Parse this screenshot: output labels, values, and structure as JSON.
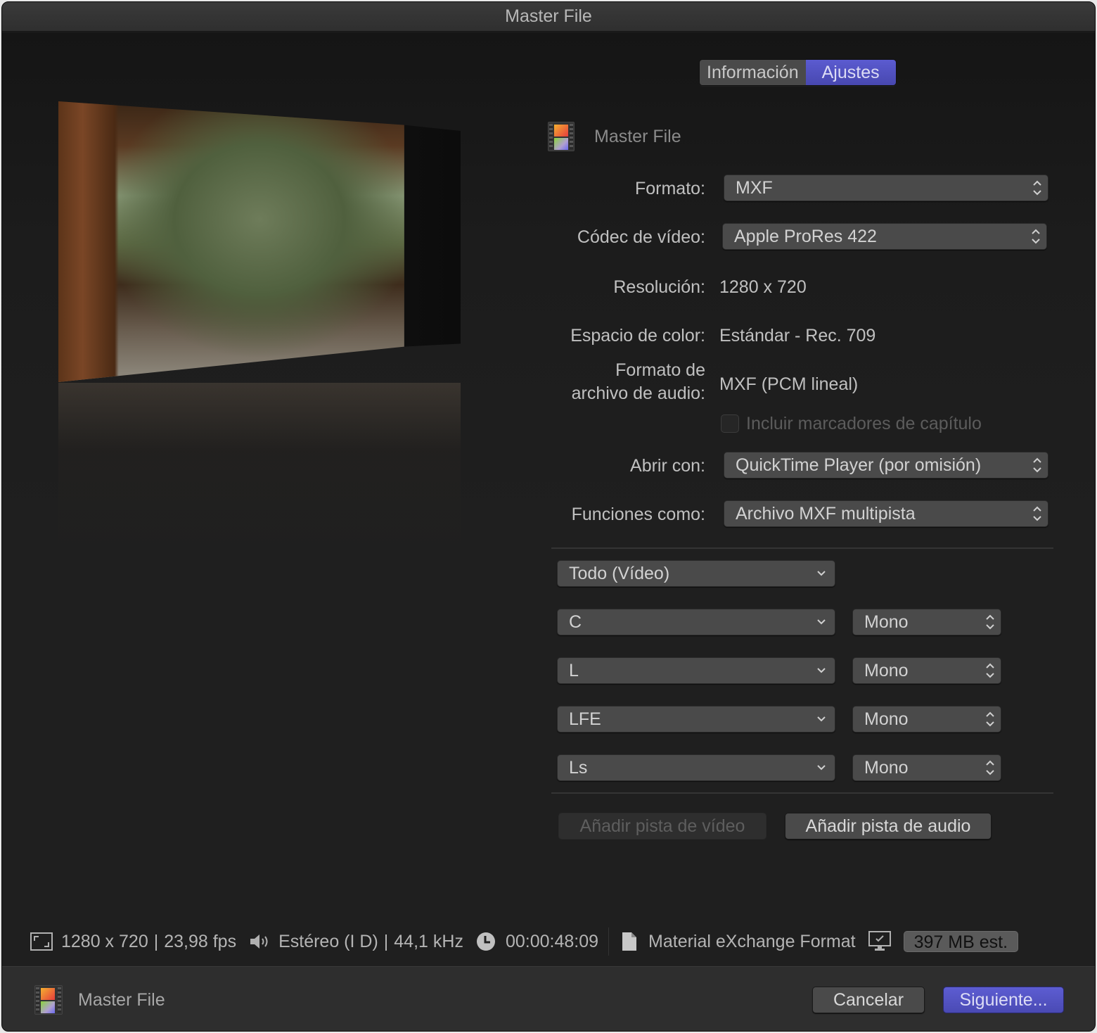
{
  "window": {
    "title": "Master File"
  },
  "tabs": [
    {
      "label": "Información",
      "active": false
    },
    {
      "label": "Ajustes",
      "active": true
    }
  ],
  "settings": {
    "name": "Master File",
    "format": {
      "label": "Formato:",
      "value": "MXF"
    },
    "video_codec": {
      "label": "Códec de vídeo:",
      "value": "Apple ProRes 422"
    },
    "resolution": {
      "label": "Resolución:",
      "value": "1280 x 720"
    },
    "color_space": {
      "label": "Espacio de color:",
      "value": "Estándar - Rec. 709"
    },
    "audio_format": {
      "label_line1": "Formato de",
      "label_line2": "archivo de audio:",
      "value": "MXF (PCM lineal)"
    },
    "chapter_markers": {
      "label": "Incluir marcadores de capítulo",
      "checked": false,
      "enabled": false
    },
    "open_with": {
      "label": "Abrir con:",
      "value": "QuickTime Player (por omisión)"
    },
    "roles_as": {
      "label": "Funciones como:",
      "value": "Archivo MXF multipista"
    }
  },
  "tracks": {
    "video": "Todo (Vídeo)",
    "audio": [
      {
        "role": "C",
        "channels": "Mono"
      },
      {
        "role": "L",
        "channels": "Mono"
      },
      {
        "role": "LFE",
        "channels": "Mono"
      },
      {
        "role": "Ls",
        "channels": "Mono"
      }
    ],
    "add_video_label": "Añadir pista de vídeo",
    "add_audio_label": "Añadir pista de audio"
  },
  "status": {
    "resolution": "1280 x 720",
    "fps": "23,98 fps",
    "audio": "Estéreo (I D)",
    "sample_rate": "44,1 kHz",
    "duration": "00:00:48:09",
    "file_format": "Material eXchange Format",
    "size": "397 MB est."
  },
  "footer": {
    "name": "Master File",
    "cancel_label": "Cancelar",
    "next_label": "Siguiente..."
  },
  "colors": {
    "accent": "#5151c4",
    "background": "#1f1f1f",
    "control": "#4a4a4a"
  }
}
